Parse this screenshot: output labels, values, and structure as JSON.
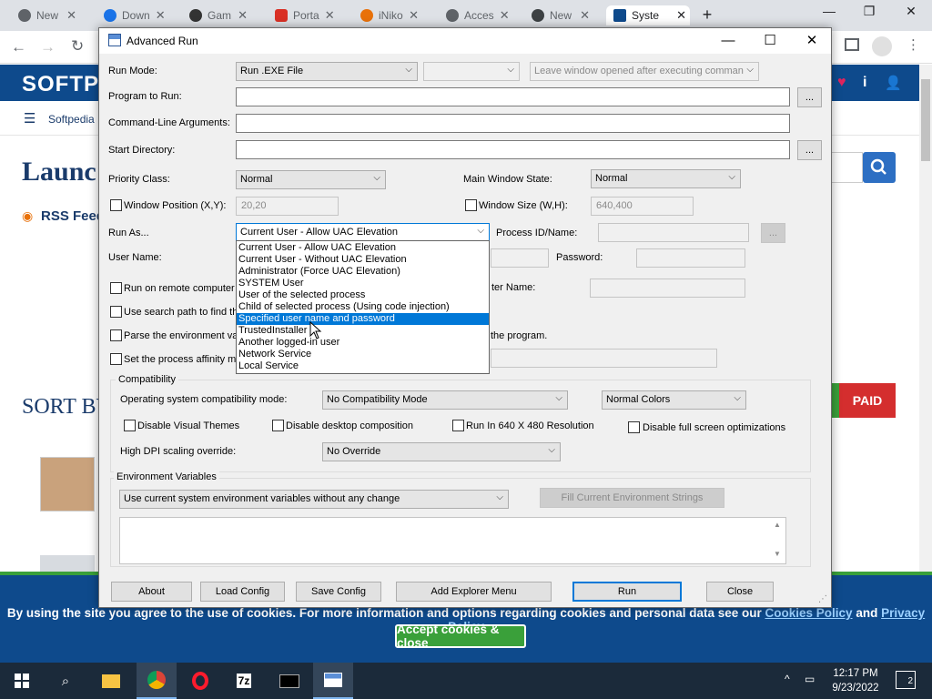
{
  "browser": {
    "tabs": [
      {
        "title": "New",
        "active": false
      },
      {
        "title": "Down",
        "active": false
      },
      {
        "title": "Gam",
        "active": false
      },
      {
        "title": "Porta",
        "active": false
      },
      {
        "title": "iNiko",
        "active": false
      },
      {
        "title": "Acces",
        "active": false
      },
      {
        "title": "New",
        "active": false
      },
      {
        "title": "Syste",
        "active": true
      }
    ]
  },
  "site": {
    "logo": "SOFTP",
    "nav_label": "Softpedia",
    "heading": "Launc",
    "rss": "RSS Feed",
    "sort": "SORT BY",
    "paid": "PAID",
    "cookie_text": "By using the site you agree to the use of cookies. For more information and options regarding cookies and personal data see our",
    "cookie_link1": "Cookies Policy",
    "cookie_and": "and",
    "cookie_link2": "Privacy Policy",
    "accept": "Accept cookies & close"
  },
  "dialog": {
    "title": "Advanced Run",
    "run_mode_label": "Run Mode:",
    "run_mode_value": "Run .EXE File",
    "leave_window": "Leave window opened after executing comman",
    "program_label": "Program to Run:",
    "cmdline_label": "Command-Line Arguments:",
    "startdir_label": "Start Directory:",
    "browse": "...",
    "priority_label": "Priority Class:",
    "priority_value": "Normal",
    "mainwin_label": "Main Window State:",
    "mainwin_value": "Normal",
    "winpos_label": "Window Position (X,Y):",
    "winpos_value": "20,20",
    "winsize_label": "Window Size (W,H):",
    "winsize_value": "640,400",
    "runas_label": "Run As...",
    "runas_value": "Current User - Allow UAC Elevation",
    "processid_label": "Process ID/Name:",
    "username_label": "User Name:",
    "password_label": "Password:",
    "remote_label": "Run on remote computer",
    "computer_name_label": "ter Name:",
    "searchpath_label": "Use search path to find th",
    "parseenv_label": "Parse the environment va",
    "parseenv_tail": "the program.",
    "affinity_label": "Set the process affinity m",
    "runas_options": [
      "Current User - Allow UAC Elevation",
      "Current User - Without UAC Elevation",
      "Administrator (Force UAC Elevation)",
      "SYSTEM User",
      "User of the selected process",
      "Child of selected process (Using code injection)",
      "Specified user name and password",
      "TrustedInstaller",
      "Another logged-in user",
      "Network Service",
      "Local Service"
    ],
    "compat_group": "Compatibility",
    "os_compat_label": "Operating system compatibility mode:",
    "os_compat_value": "No Compatibility Mode",
    "colors_value": "Normal Colors",
    "disable_themes": "Disable Visual Themes",
    "disable_desktop": "Disable desktop composition",
    "run640": "Run In 640 X 480 Resolution",
    "disable_fullscreen": "Disable full screen optimizations",
    "dpi_label": "High DPI scaling override:",
    "dpi_value": "No Override",
    "env_group": "Environment Variables",
    "env_value": "Use current system environment variables without any change",
    "fill_env": "Fill Current Environment Strings",
    "buttons": {
      "about": "About",
      "load": "Load Config",
      "save": "Save Config",
      "explorer": "Add Explorer Menu",
      "run": "Run",
      "close": "Close"
    }
  },
  "taskbar": {
    "time": "12:17 PM",
    "date": "9/23/2022",
    "notifications": "2"
  }
}
